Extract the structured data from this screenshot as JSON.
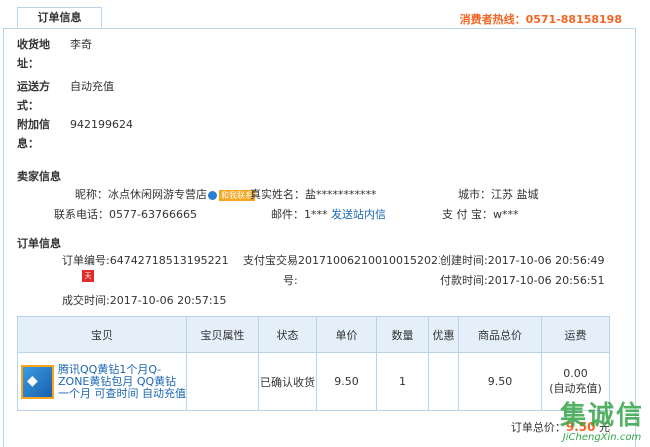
{
  "tab_label": "订单信息",
  "hotline": "消费者热线：0571-88158198",
  "consignee": {
    "address_label_1": "收货地",
    "address_label_2": "址：",
    "address_value": "李奇",
    "delivery_label_1": "运送方",
    "delivery_label_2": "式：",
    "delivery_value": "自动充值",
    "extra_label_1": "附加信",
    "extra_label_2": "息：",
    "extra_value": "942199624"
  },
  "seller": {
    "section_title": "卖家信息",
    "nickname_label": "昵称：",
    "nickname_value": "冰点休闲网游专营店",
    "contact_badge": "和我联系",
    "realname_label": "真实姓名：",
    "realname_value": "盐***********",
    "city_label": "城市：",
    "city_value": "江苏 盐城",
    "phone_label": "联系电话：",
    "phone_value": "0577-63766665",
    "email_label": "邮件：",
    "email_value": "1***",
    "email_link": "发送站内信",
    "alipay_label": "支 付 宝：",
    "alipay_value": "w***"
  },
  "order": {
    "section_title": "订单信息",
    "order_no": "订单编号:64742718513195221",
    "alipay_trade_1": "支付宝交易2017100621001001520235",
    "alipay_trade_2": "号:",
    "created": "创建时间:2017-10-06 20:56:49",
    "paid": "付款时间:2017-10-06 20:56:51",
    "shop_icon_text": "天猫",
    "deal_time": "成交时间:2017-10-06 20:57:15"
  },
  "table": {
    "headers": [
      "宝贝",
      "宝贝属性",
      "状态",
      "单价",
      "数量",
      "优惠",
      "商品总价",
      "运费"
    ],
    "row": {
      "product_name": "腾讯QQ黄钻1个月Q-ZONE黄钻包月 QQ黄钻一个月 可查时间 自动充值",
      "attributes": "",
      "status": "已确认收货",
      "unit_price": "9.50",
      "quantity": "1",
      "discount": "",
      "total": "9.50",
      "shipping_1": "0.00",
      "shipping_2": "(自动充值)"
    }
  },
  "order_total_label": "订单总价：",
  "order_total_value": "9.50",
  "order_total_unit": "元",
  "watermark_big": "集诚信",
  "watermark_small": "JiChengXin.com"
}
